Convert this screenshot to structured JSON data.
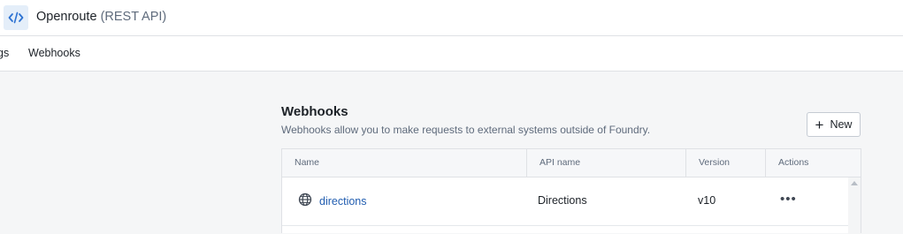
{
  "header": {
    "app_icon": "code-icon",
    "title": "Openroute",
    "subtitle": "(REST API)"
  },
  "tabs": [
    {
      "label": "gs"
    },
    {
      "label": "Webhooks"
    }
  ],
  "section": {
    "title": "Webhooks",
    "description": "Webhooks allow you to make requests to external systems outside of Foundry.",
    "new_button_label": "New"
  },
  "table": {
    "columns": [
      "Name",
      "API name",
      "Version",
      "Actions"
    ],
    "rows": [
      {
        "name": "directions",
        "name_icon": "globe-icon",
        "api_name": "Directions",
        "version": "v10",
        "actions": "•••"
      }
    ]
  },
  "colors": {
    "accent": "#215db0",
    "app_icon_bg": "#e4eef9",
    "background": "#f5f6f7"
  }
}
